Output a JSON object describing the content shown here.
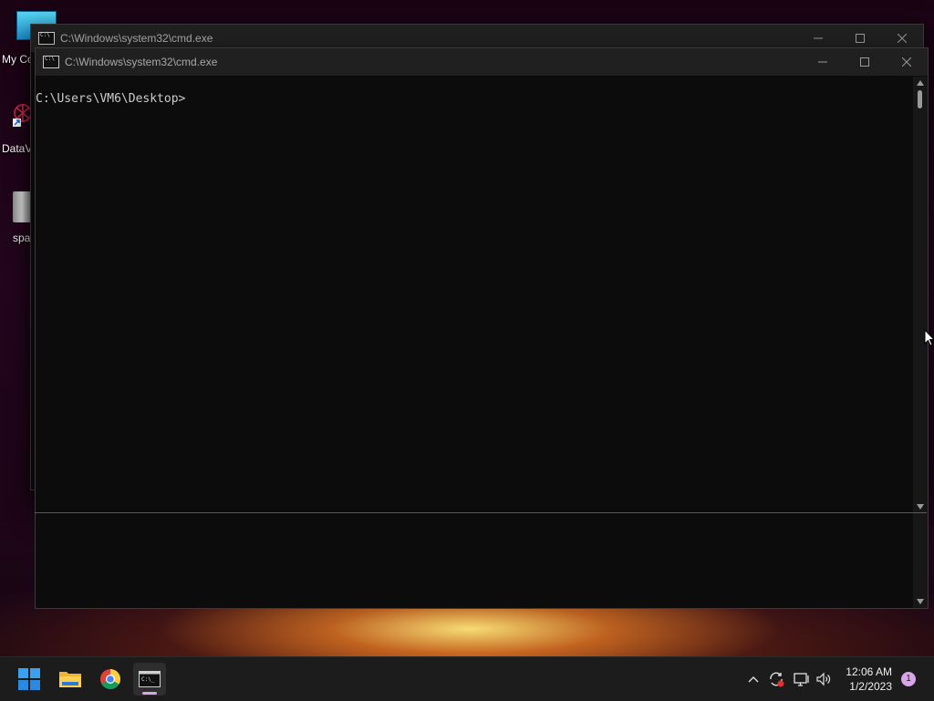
{
  "desktop": {
    "icons": [
      {
        "label": "My Co",
        "sub": "C"
      },
      {
        "label": "DataV"
      },
      {
        "label": "spa"
      }
    ]
  },
  "windows": {
    "back": {
      "title": "C:\\Windows\\system32\\cmd.exe"
    },
    "front": {
      "title": "C:\\Windows\\system32\\cmd.exe",
      "prompt": "C:\\Users\\VM6\\Desktop>"
    }
  },
  "taskbar": {
    "apps": [
      "windows-start-icon",
      "file-explorer-icon",
      "chrome-icon",
      "cmd-icon"
    ],
    "clock": {
      "time": "12:06 AM",
      "date": "1/2/2023"
    },
    "notifications": "1"
  },
  "colors": {
    "console_bg": "#0c0c0c",
    "titlebar_bg": "#202020",
    "taskbar_bg": "#1c1c1c",
    "accent": "#d8a6e8"
  }
}
